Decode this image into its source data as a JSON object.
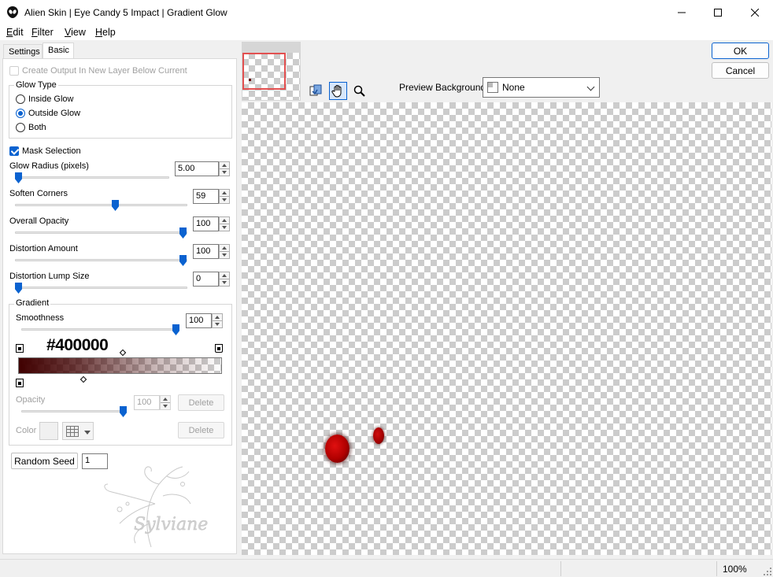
{
  "window": {
    "title": "Alien Skin | Eye Candy 5 Impact | Gradient Glow"
  },
  "menu": {
    "items": [
      {
        "label": "Edit",
        "key": "E",
        "rest": "dit"
      },
      {
        "label": "Filter",
        "key": "F",
        "rest": "ilter"
      },
      {
        "label": "View",
        "key": "V",
        "rest": "iew"
      },
      {
        "label": "Help",
        "key": "H",
        "rest": "elp"
      }
    ]
  },
  "tabs": [
    "Settings",
    "Basic"
  ],
  "basic": {
    "create_output_label": "Create Output In New Layer Below Current",
    "glow_type": {
      "title": "Glow Type",
      "options": [
        "Inside Glow",
        "Outside Glow",
        "Both"
      ],
      "selected": "Outside Glow"
    },
    "mask_selection_label": "Mask Selection",
    "glow_radius": {
      "label": "Glow Radius (pixels)",
      "value": "5.00"
    },
    "soften_corners": {
      "label": "Soften Corners",
      "value": "59"
    },
    "overall_opacity": {
      "label": "Overall Opacity",
      "value": "100"
    },
    "distortion_amount": {
      "label": "Distortion Amount",
      "value": "100"
    },
    "distortion_lump_size": {
      "label": "Distortion Lump Size",
      "value": "0"
    },
    "gradient": {
      "title": "Gradient",
      "smoothness_label": "Smoothness",
      "smoothness_value": "100",
      "color_hex": "#400000",
      "opacity_label": "Opacity",
      "opacity_value": "100",
      "delete_label": "Delete",
      "color_label": "Color",
      "delete2_label": "Delete"
    },
    "random_seed_label": "Random Seed",
    "random_seed_value": "1"
  },
  "signature_text": "Sylviane",
  "buttons": {
    "ok": "OK",
    "cancel": "Cancel"
  },
  "preview_background": {
    "label": "Preview Background:",
    "value": "None"
  },
  "status": {
    "zoom": "100%"
  },
  "colors": {
    "accent": "#0a62d0",
    "glow_color": "#400000",
    "nav_rect": "#e25050"
  }
}
